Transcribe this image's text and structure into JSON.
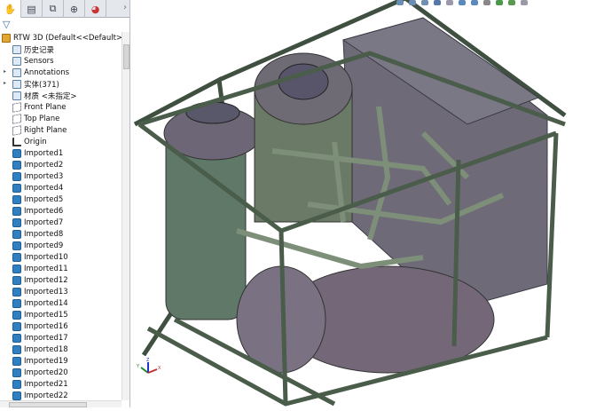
{
  "tabs": [
    {
      "name": "feature-manager",
      "icon": "feature-manager-icon"
    },
    {
      "name": "property-manager",
      "icon": "property-icon"
    },
    {
      "name": "configuration-manager",
      "icon": "configuration-icon"
    },
    {
      "name": "dimxpert-manager",
      "icon": "crosshair-icon"
    },
    {
      "name": "display-manager",
      "icon": "appearance-icon"
    }
  ],
  "tab_more": "›",
  "filter_icon": "filter-icon",
  "tree": {
    "root": "RTW 3D  (Default<<Default>_Displ",
    "items": [
      {
        "label": "历史记录",
        "icon": "history-folder-icon",
        "expand": false
      },
      {
        "label": "Sensors",
        "icon": "sensors-folder-icon",
        "expand": false
      },
      {
        "label": "Annotations",
        "icon": "annotations-folder-icon",
        "expand": true
      },
      {
        "label": "实体(371)",
        "icon": "solid-bodies-folder-icon",
        "expand": true
      },
      {
        "label": "材质 <未指定>",
        "icon": "material-icon",
        "expand": false
      },
      {
        "label": "Front Plane",
        "icon": "plane-icon",
        "expand": false
      },
      {
        "label": "Top Plane",
        "icon": "plane-icon",
        "expand": false
      },
      {
        "label": "Right Plane",
        "icon": "plane-icon",
        "expand": false
      },
      {
        "label": "Origin",
        "icon": "origin-icon",
        "expand": false
      }
    ],
    "parts": [
      "Imported1",
      "Imported2",
      "Imported3",
      "Imported4",
      "Imported5",
      "Imported6",
      "Imported7",
      "Imported8",
      "Imported9",
      "Imported10",
      "Imported11",
      "Imported12",
      "Imported13",
      "Imported14",
      "Imported15",
      "Imported16",
      "Imported17",
      "Imported18",
      "Imported19",
      "Imported20",
      "Imported21",
      "Imported22"
    ]
  },
  "triad": {
    "x": "X",
    "y": "Y",
    "z": "Z"
  },
  "colors": {
    "frame": "#4a5a4a",
    "tank": "#6f6a78",
    "tank_green": "#5f7a6c",
    "pipes": "#7a8a78"
  }
}
